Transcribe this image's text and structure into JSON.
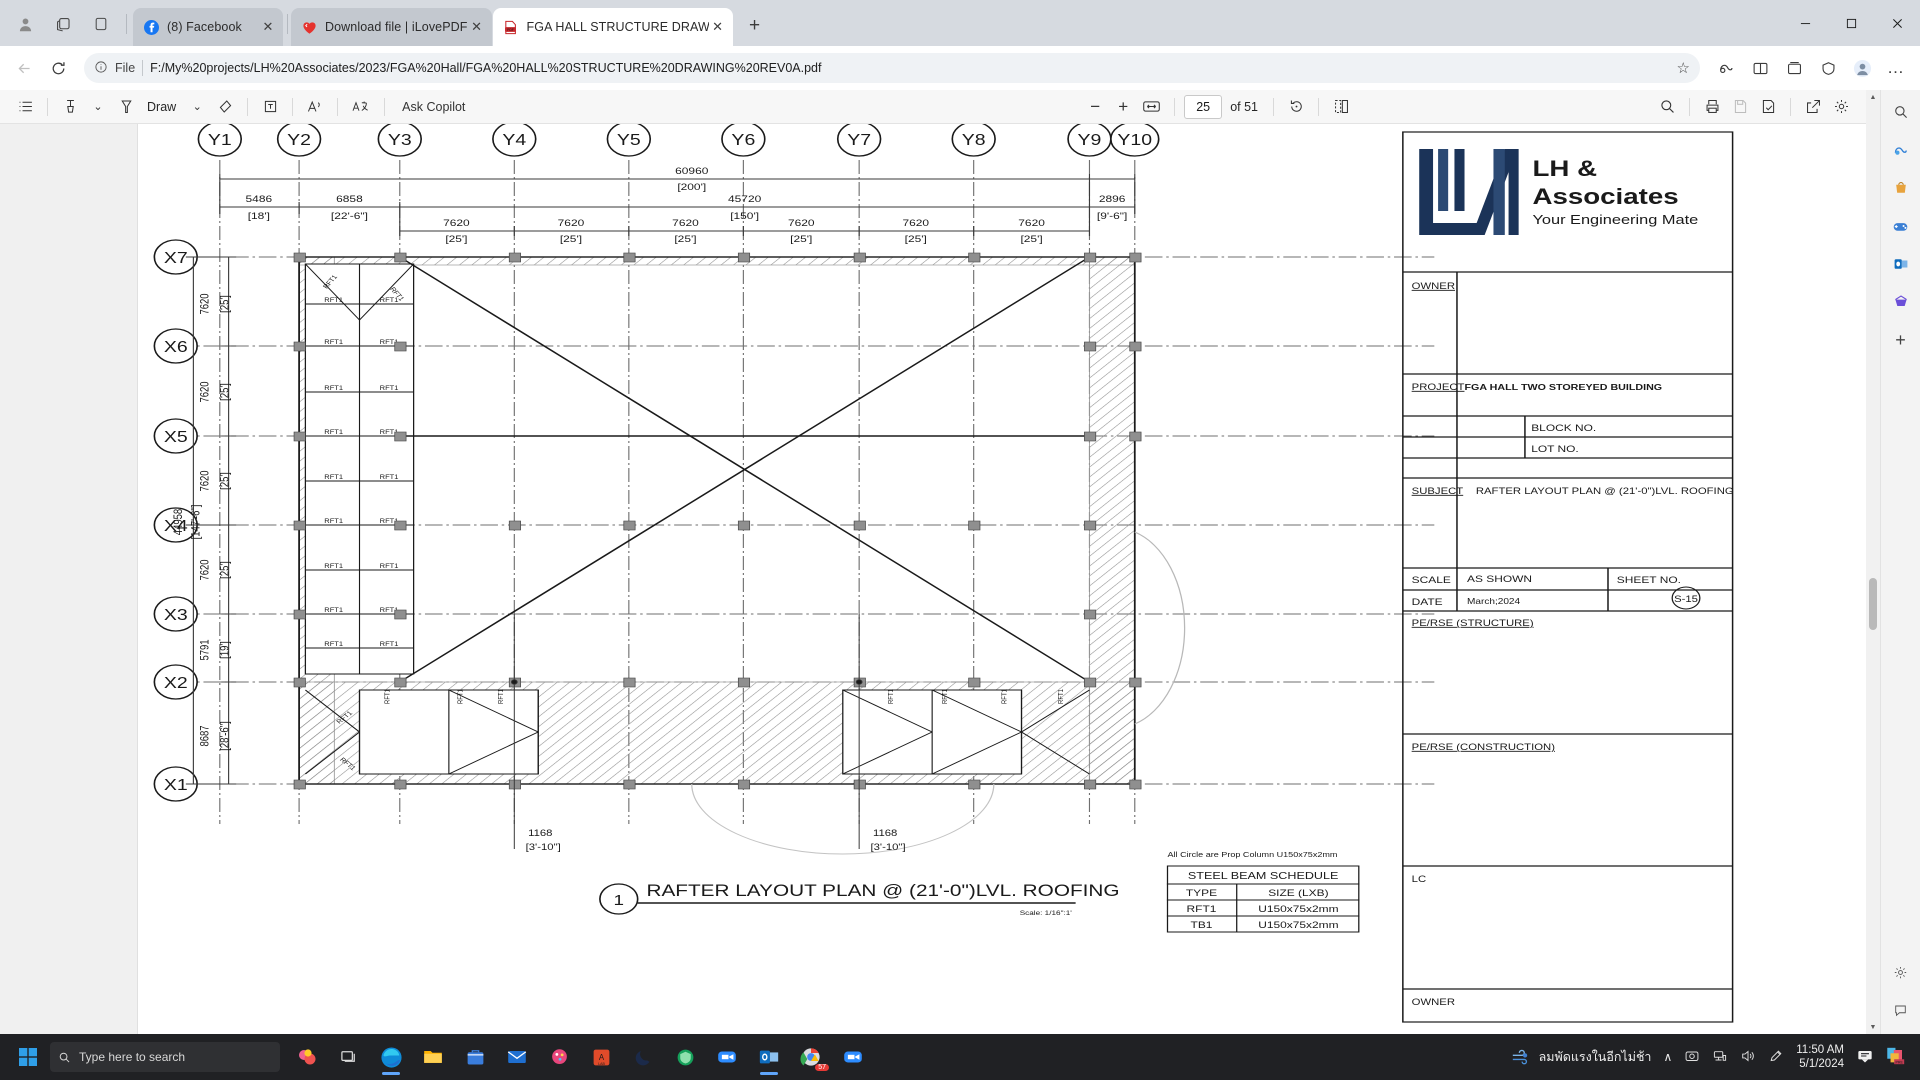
{
  "window": {
    "minimize": "—",
    "maximize": "▢",
    "close": "✕"
  },
  "tabstrip": {
    "profile_icon": "profile-icon",
    "tabs": [
      {
        "label": "(8) Facebook",
        "favicon": "facebook-icon",
        "close": "✕",
        "active": false
      },
      {
        "label": "Download file | iLovePDF",
        "favicon": "ilovepdf-icon",
        "close": "✕",
        "active": false
      },
      {
        "label": "FGA HALL STRUCTURE DRAWING",
        "favicon": "pdf-icon",
        "close": "✕",
        "active": true
      }
    ],
    "new_tab": "+"
  },
  "navbar": {
    "back": "←",
    "forward": "→",
    "reload": "⟳",
    "scheme_label": "File",
    "url": "F:/My%20projects/LH%20Associates/2023/FGA%20Hall/FGA%20HALL%20STRUCTURE%20DRAWING%20REV0A.pdf",
    "favorite": "☆",
    "copilot": "copilot-icon",
    "split_screen": "split-screen-icon",
    "collections": "collections-icon",
    "browser_essentials": "browser-essentials-icon",
    "settings_more": "…"
  },
  "pdf_toolbar": {
    "toc": "table-of-contents-icon",
    "highlight": "highlight-icon",
    "highlight_caret": "⌄",
    "draw": "Draw",
    "draw_caret": "⌄",
    "erase": "erase-icon",
    "text_box": "text-box-icon",
    "read_aloud": "read-aloud-icon",
    "translate": "translate-icon",
    "ask_copilot": "Ask Copilot",
    "zoom_out": "−",
    "zoom_in": "+",
    "fit_page": "fit-page-icon",
    "page_value": "25",
    "page_total": "of 51",
    "rotate": "rotate-icon",
    "page_view": "page-view-icon",
    "search": "search-icon",
    "print": "print-icon",
    "save": "save-icon",
    "save_as": "save-as-icon",
    "share": "share-icon",
    "more_settings": "settings-icon"
  },
  "edge_sidebar": {
    "search": "search-icon",
    "copilot": "copilot-icon",
    "shopping": "shopping-icon",
    "games": "games-icon",
    "outlook": "outlook-icon",
    "tools": "tools-icon",
    "add": "+",
    "settings": "gear-icon",
    "feedback": "feedback-icon"
  },
  "drawing": {
    "title_number": "1",
    "title": "RAFTER LAYOUT PLAN @ (21'-0\")LVL. ROOFING",
    "scale_note": "Scale: 1/16\":1'",
    "circle_note": "All Circle  are Prop Column U150x75x2mm",
    "grid_top": [
      "Y1",
      "Y2",
      "Y3",
      "Y4",
      "Y5",
      "Y6",
      "Y7",
      "Y8",
      "Y9",
      "Y10"
    ],
    "grid_left": [
      "X7",
      "X6",
      "X5",
      "X4",
      "X3",
      "X2",
      "X1"
    ],
    "overall_dim_mm": "60960",
    "overall_dim_ft": "[200']",
    "inner_dim_mm": "45720",
    "inner_dim_ft": "[150']",
    "top_dims": [
      {
        "mm": "5486",
        "ft": "[18']"
      },
      {
        "mm": "6858",
        "ft": "[22'-6\"]"
      },
      {
        "mm": "2896",
        "ft": "[9'-6\"]"
      }
    ],
    "bay_dims": [
      {
        "mm": "7620",
        "ft": "[25']"
      },
      {
        "mm": "7620",
        "ft": "[25']"
      },
      {
        "mm": "7620",
        "ft": "[25']"
      },
      {
        "mm": "7620",
        "ft": "[25']"
      },
      {
        "mm": "7620",
        "ft": "[25']"
      },
      {
        "mm": "7620",
        "ft": "[25']"
      }
    ],
    "left_total_mm": "44958",
    "left_total_ft": "[147'-6\"]",
    "left_dims": [
      {
        "mm": "7620",
        "ft": "[25']"
      },
      {
        "mm": "7620",
        "ft": "[25']"
      },
      {
        "mm": "7620",
        "ft": "[25']"
      },
      {
        "mm": "7620",
        "ft": "[25']"
      },
      {
        "mm": "5791",
        "ft": "[19']"
      },
      {
        "mm": "8687",
        "ft": "[28'-6\"]"
      }
    ],
    "bottom_dims": [
      {
        "mm": "1168",
        "ft": "[3'-10\"]"
      },
      {
        "mm": "1168",
        "ft": "[3'-10\"]"
      }
    ],
    "member_label": "RFT1",
    "schedule": {
      "title": "STEEL BEAM SCHEDULE",
      "headers": [
        "TYPE",
        "SIZE (LXB)"
      ],
      "rows": [
        [
          "RFT1",
          "U150x75x2mm"
        ],
        [
          "TB1",
          "U150x75x2mm"
        ]
      ]
    }
  },
  "titleblock": {
    "logo_line1": "LH &",
    "logo_line2": "Associates",
    "logo_tagline": "Your Engineering Mate",
    "owner_label": "OWNER",
    "project_label": "PROJECT",
    "project_value": "FGA HALL TWO STOREYED BUILDING",
    "block_no_label": "BLOCK NO.",
    "block_no_value": "",
    "lot_no_label": "LOT NO.",
    "lot_no_value": "",
    "subject_label": "SUBJECT",
    "subject_value": "RAFTER LAYOUT PLAN @ (21'-0\")LVL. ROOFING",
    "scale_label": "SCALE",
    "scale_value": "AS SHOWN",
    "date_label": "DATE",
    "date_value": "March;2024",
    "sheet_no_label": "SHEET NO.",
    "sheet_no_value": "S-15",
    "pe_structure_label": "PE/RSE (STRUCTURE)",
    "pe_construction_label": "PE/RSE (CONSTRUCTION)",
    "lc_label": "LC",
    "owner2_label": "OWNER"
  },
  "taskbar": {
    "search_placeholder": "Type here to search",
    "weather_text": "ลมพัดแรงในอีกไม่ช้า",
    "time": "11:50 AM",
    "date": "5/1/2024",
    "apps": [
      "start-icon",
      "search-icon",
      "widgets-icon",
      "task-view-icon",
      "edge-icon",
      "file-explorer-icon",
      "store-icon",
      "mail-icon",
      "paint-icon",
      "acad-icon",
      "moon-icon",
      "antivirus-icon",
      "zoom-icon",
      "outlook-icon",
      "chrome-icon",
      "zoom2-icon"
    ],
    "badge_zoom": "57",
    "show_hidden": "∧",
    "camera": "camera-icon",
    "network": "network-icon",
    "volume": "volume-icon",
    "pen": "pen-icon",
    "notification": "notification-icon",
    "pre_icon": "pre-icon"
  },
  "colors": {
    "accent": "#1b3358",
    "tab_active": "#ffffff",
    "chrome_bg": "#d6dae0",
    "taskbar": "#202124"
  }
}
